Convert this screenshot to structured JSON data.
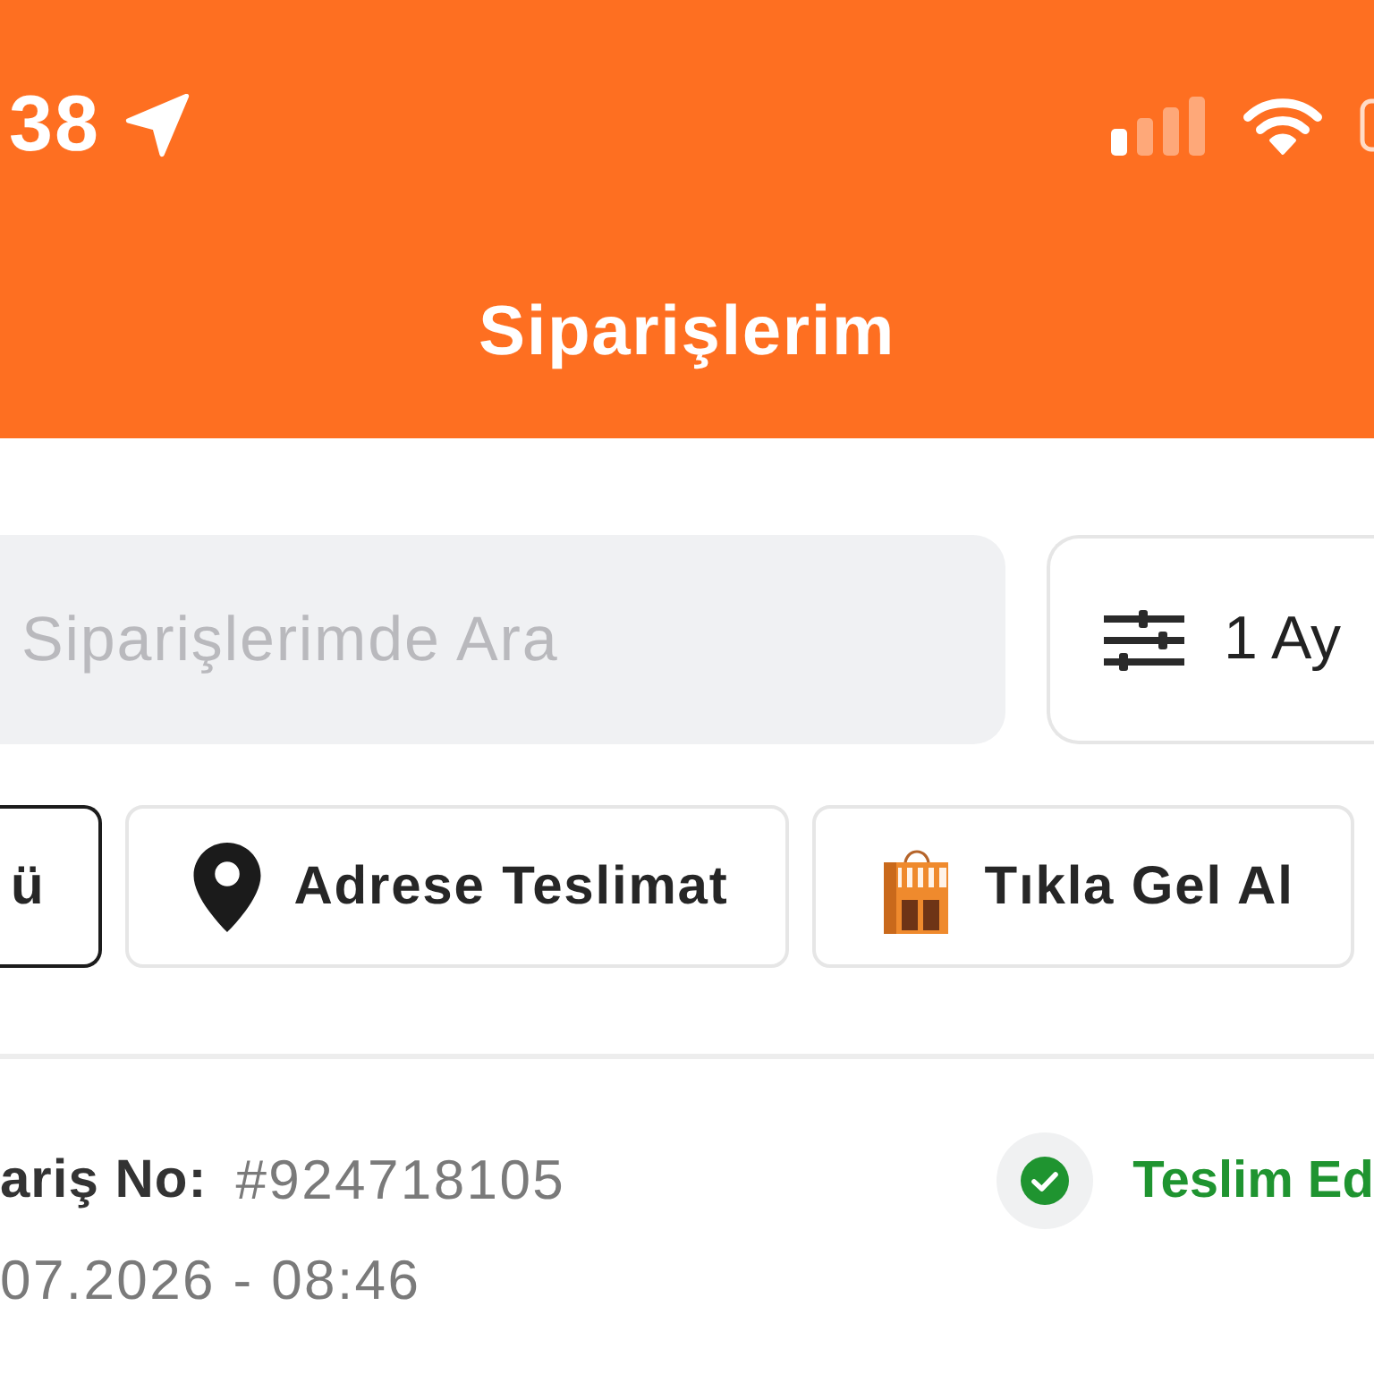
{
  "status_bar": {
    "time": "38"
  },
  "header": {
    "title": "Siparişlerim"
  },
  "search": {
    "placeholder": "Siparişlerimde Ara"
  },
  "period_filter": {
    "label": "1 Ay"
  },
  "filters": [
    {
      "kind": "all",
      "label": "ü",
      "selected": true
    },
    {
      "kind": "delivery",
      "label": "Adrese Teslimat",
      "selected": false
    },
    {
      "kind": "pickup",
      "label": "Tıkla Gel Al",
      "selected": false
    }
  ],
  "orders": [
    {
      "kind": "delivered",
      "number_label": "ariş No:",
      "number": "#924718105",
      "date": "07.2026 - 08:46",
      "status": "Teslim Ed"
    }
  ]
}
